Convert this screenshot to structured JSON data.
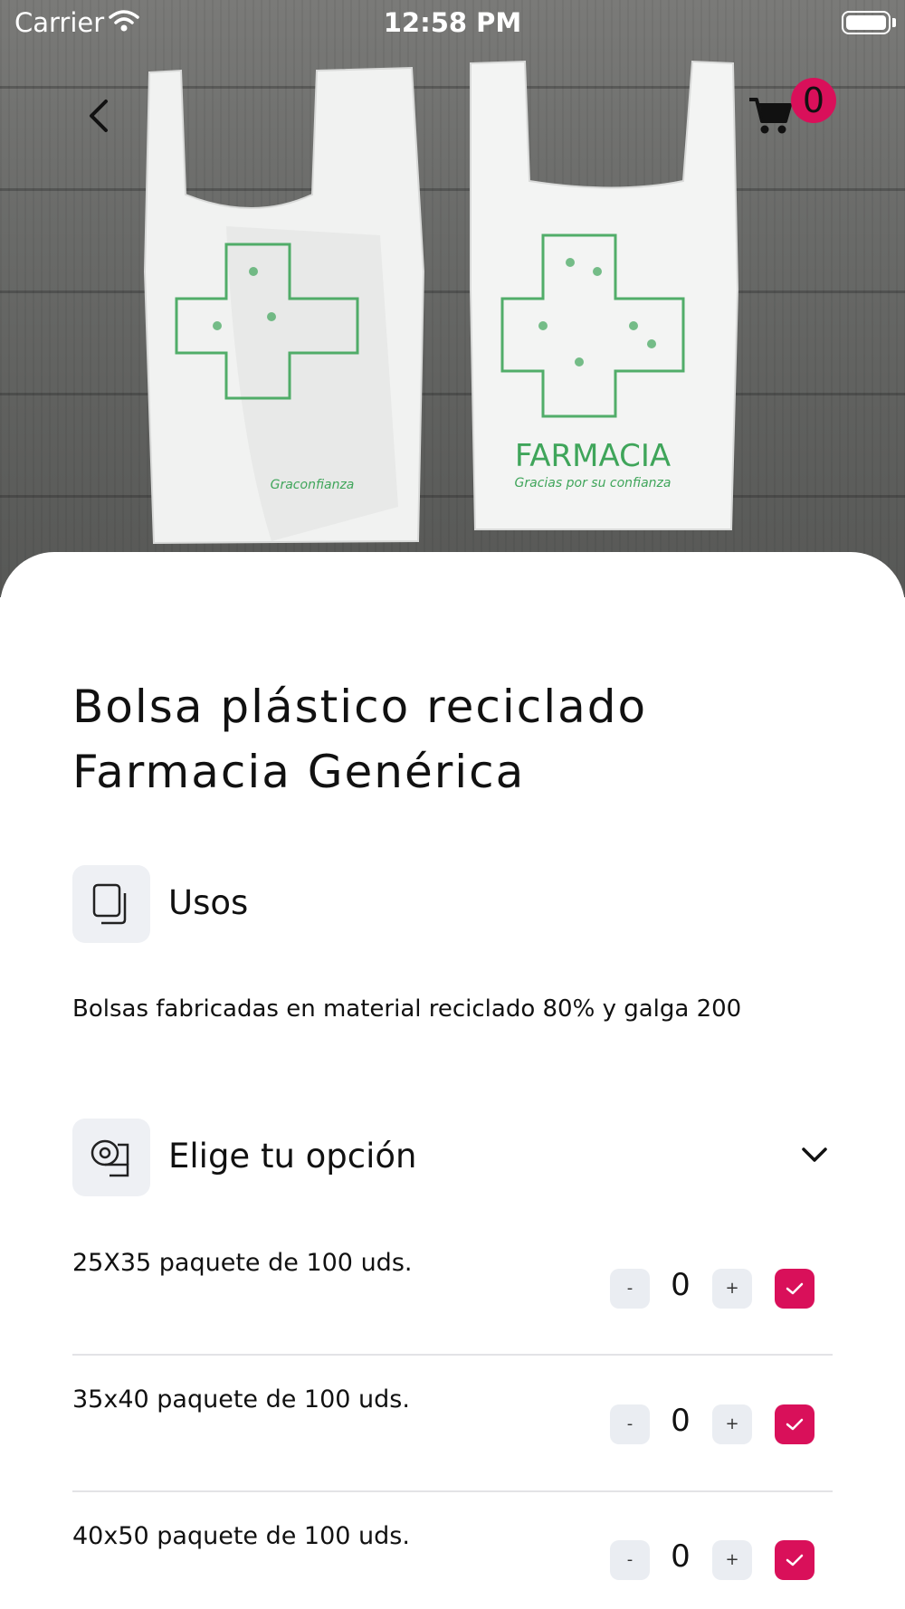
{
  "status_bar": {
    "carrier": "Carrier",
    "time": "12:58 PM"
  },
  "cart": {
    "count": "0"
  },
  "hero": {
    "bag_brand": "FARMACIA",
    "bag_slogan": "Gracias por su confianza",
    "bag_left_fragment": "Graconfianza"
  },
  "product": {
    "title_line1": "Bolsa plástico reciclado",
    "title_line2": "Farmacia Genérica"
  },
  "uses_section": {
    "label": "Usos",
    "description": "Bolsas fabricadas en material reciclado 80% y galga 200"
  },
  "options_section": {
    "label": "Elige tu opción",
    "items": [
      {
        "label": "25X35 paquete de 100 uds.",
        "quantity": "0",
        "minus": "-",
        "plus": "+",
        "selected": true
      },
      {
        "label": "35x40 paquete de 100 uds.",
        "quantity": "0",
        "minus": "-",
        "plus": "+",
        "selected": true
      },
      {
        "label": "40x50 paquete de 100 uds.",
        "quantity": "0",
        "minus": "-",
        "plus": "+",
        "selected": true
      }
    ]
  },
  "colors": {
    "accent": "#d9105a",
    "icon_bg": "#eef0f4",
    "stepper_bg": "#eaedf2",
    "bag_print": "#3fa55a"
  }
}
